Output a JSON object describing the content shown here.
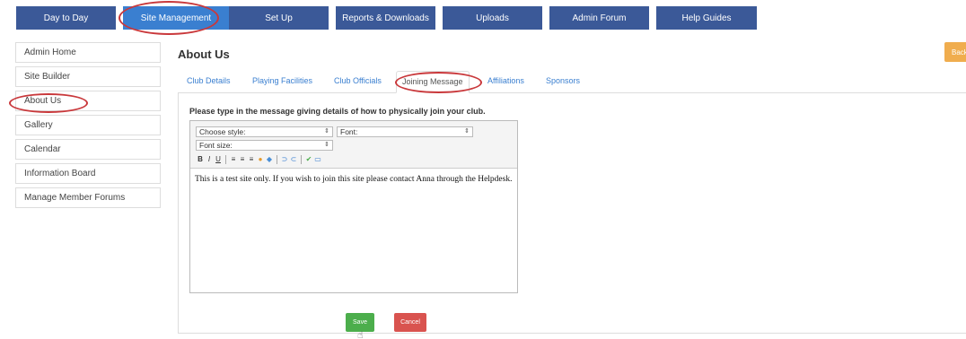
{
  "topnav": {
    "tabs": [
      {
        "label": "Day to Day"
      },
      {
        "label": "Site Management"
      },
      {
        "label": "Set Up"
      },
      {
        "label": "Reports & Downloads"
      },
      {
        "label": "Uploads"
      },
      {
        "label": "Admin Forum"
      },
      {
        "label": "Help Guides"
      }
    ]
  },
  "sidebar": {
    "items": [
      {
        "label": "Admin Home"
      },
      {
        "label": "Site Builder"
      },
      {
        "label": "About Us"
      },
      {
        "label": "Gallery"
      },
      {
        "label": "Calendar"
      },
      {
        "label": "Information Board"
      },
      {
        "label": "Manage Member Forums"
      }
    ]
  },
  "main": {
    "title": "About Us",
    "back_label": "Back",
    "tabs": [
      {
        "label": "Club Details"
      },
      {
        "label": "Playing Facilities"
      },
      {
        "label": "Club Officials"
      },
      {
        "label": "Joining Message"
      },
      {
        "label": "Affiliations"
      },
      {
        "label": "Sponsors"
      }
    ],
    "instruction": "Please type in the message giving details of how to physically join your club.",
    "editor": {
      "style_select": "Choose style:",
      "font_select": "Font:",
      "size_select": "Font size:",
      "toolbar": {
        "bold": "B",
        "italic": "I",
        "underline": "U"
      },
      "content": "This is a test site only. If you wish to join this site please contact Anna through the Helpdesk."
    },
    "save_label": "Save",
    "cancel_label": "Cancel"
  },
  "colors": {
    "nav": "#3b5998",
    "nav_active": "#3a7fd0",
    "highlight_circle": "#c9383b",
    "save": "#4cae4c",
    "cancel": "#d9534f",
    "back": "#f0ad4e"
  }
}
